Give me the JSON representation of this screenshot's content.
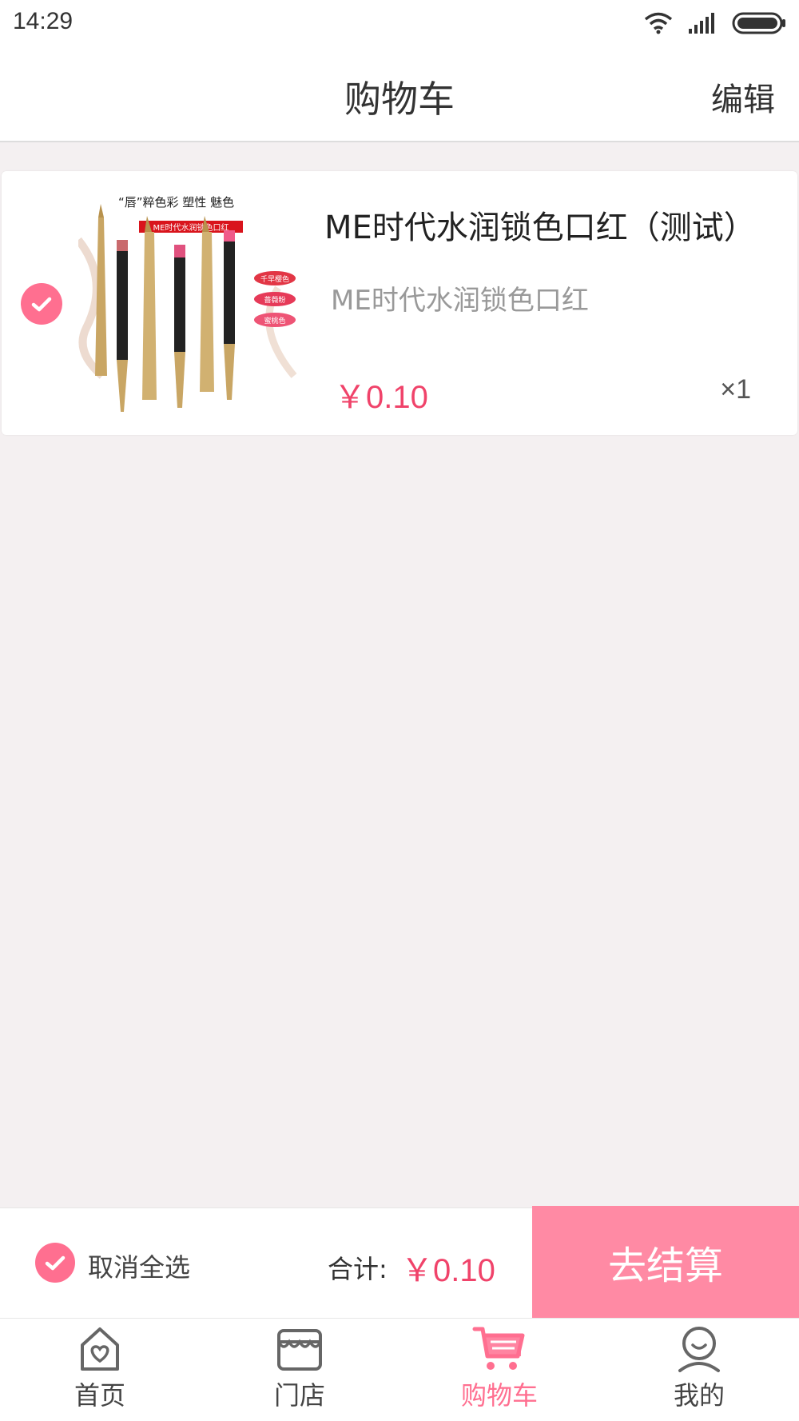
{
  "status_bar": {
    "time": "14:29"
  },
  "header": {
    "title": "购物车",
    "edit_label": "编辑"
  },
  "cart_item": {
    "name": "ME时代水润锁色口红（测试）",
    "subtitle": "ME时代水润锁色口红",
    "price": "￥0.10",
    "quantity": "×1",
    "selected": true,
    "image_text": {
      "tagline": "“唇”粹色彩 塑性 魅色",
      "banner": "ME时代水润锁色口红",
      "shade_1": "千早樱色",
      "shade_2": "蔷薇粉",
      "shade_3": "蜜桃色"
    }
  },
  "checkout": {
    "select_all_label": "取消全选",
    "total_label": "合计:",
    "total_value": "￥0.10",
    "checkout_button_label": "去结算"
  },
  "tabs": [
    {
      "label": "首页",
      "icon": "home-heart-icon"
    },
    {
      "label": "门店",
      "icon": "store-icon"
    },
    {
      "label": "购物车",
      "icon": "cart-icon",
      "active": true
    },
    {
      "label": "我的",
      "icon": "user-icon"
    }
  ],
  "colors": {
    "accent": "#ff6f90",
    "price": "#f0436a",
    "checkout_button": "#ff8aa4",
    "background": "#f4f0f1"
  }
}
